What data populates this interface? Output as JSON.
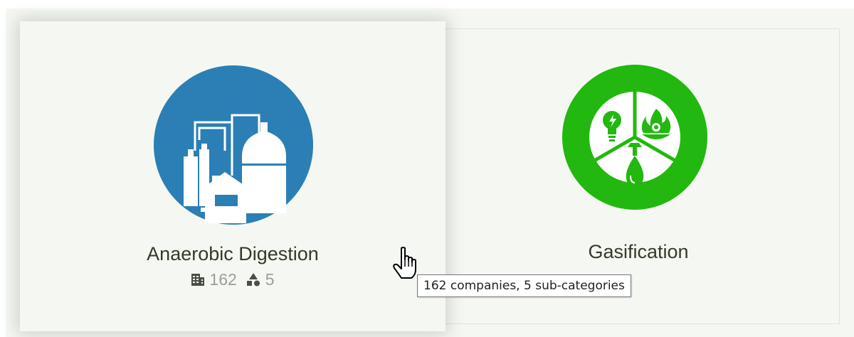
{
  "cards": [
    {
      "title": "Anaerobic Digestion",
      "companies_count": "162",
      "subcategories_count": "5",
      "icon": "biogas-plant-icon",
      "color": "#2b7fb5"
    },
    {
      "title": "Gasification",
      "icon": "gasification-icon",
      "color": "#22b80f"
    }
  ],
  "tooltip": {
    "text": "162 companies, 5 sub-categories"
  },
  "stat_icons": {
    "companies": "building-icon",
    "subcategories": "shapes-icon"
  }
}
